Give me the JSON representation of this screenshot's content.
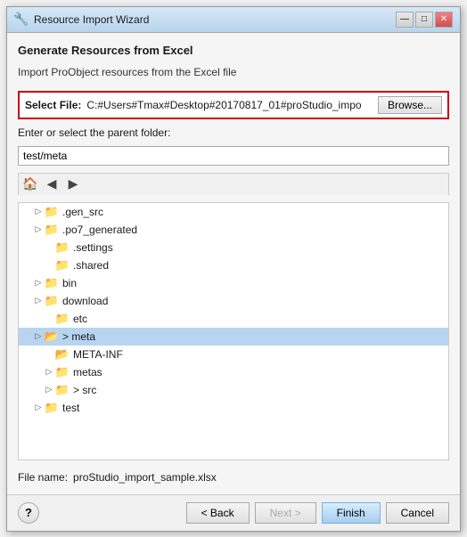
{
  "titleBar": {
    "title": "Resource Import Wizard",
    "icon": "🔧",
    "buttons": {
      "minimize": "—",
      "maximize": "□",
      "close": "✕"
    }
  },
  "dialog": {
    "sectionTitle": "Generate Resources from Excel",
    "sectionSubtitle": "Import ProObject resources from the Excel file",
    "fileSelect": {
      "label": "Select File:",
      "value": "C:#Users#Tmax#Desktop#20170817_01#proStudio_impo",
      "placeholder": ""
    },
    "browseButton": "Browse...",
    "folderLabel": "Enter or select the parent folder:",
    "folderPath": "test/meta",
    "treeToolbar": {
      "homeTitle": "Home",
      "backTitle": "Back",
      "forwardTitle": "Forward"
    },
    "treeItems": [
      {
        "id": "gen_src",
        "label": ".gen_src",
        "indent": 1,
        "hasToggle": true,
        "expanded": false,
        "type": "folder"
      },
      {
        "id": "po7_generated",
        "label": ".po7_generated",
        "indent": 1,
        "hasToggle": true,
        "expanded": false,
        "type": "folder"
      },
      {
        "id": "settings",
        "label": ".settings",
        "indent": 1,
        "hasToggle": false,
        "expanded": false,
        "type": "folder"
      },
      {
        "id": "shared",
        "label": ".shared",
        "indent": 1,
        "hasToggle": false,
        "expanded": false,
        "type": "folder"
      },
      {
        "id": "bin",
        "label": "bin",
        "indent": 1,
        "hasToggle": true,
        "expanded": false,
        "type": "folder"
      },
      {
        "id": "download",
        "label": "download",
        "indent": 1,
        "hasToggle": true,
        "expanded": false,
        "type": "folder"
      },
      {
        "id": "etc",
        "label": "etc",
        "indent": 1,
        "hasToggle": false,
        "expanded": false,
        "type": "folder"
      },
      {
        "id": "meta",
        "label": "> meta",
        "indent": 1,
        "hasToggle": true,
        "expanded": true,
        "type": "folder-special",
        "selected": true
      },
      {
        "id": "META-INF",
        "label": "META-INF",
        "indent": 2,
        "hasToggle": false,
        "expanded": false,
        "type": "folder-special"
      },
      {
        "id": "metas",
        "label": "metas",
        "indent": 2,
        "hasToggle": true,
        "expanded": false,
        "type": "folder"
      },
      {
        "id": "src",
        "label": "> src",
        "indent": 2,
        "hasToggle": true,
        "expanded": false,
        "type": "folder"
      },
      {
        "id": "test",
        "label": "test",
        "indent": 1,
        "hasToggle": true,
        "expanded": false,
        "type": "folder"
      }
    ],
    "fileName": {
      "label": "File name:",
      "value": "proStudio_import_sample.xlsx"
    },
    "footer": {
      "helpTitle": "?",
      "backButton": "< Back",
      "nextButton": "Next >",
      "finishButton": "Finish",
      "cancelButton": "Cancel"
    }
  }
}
